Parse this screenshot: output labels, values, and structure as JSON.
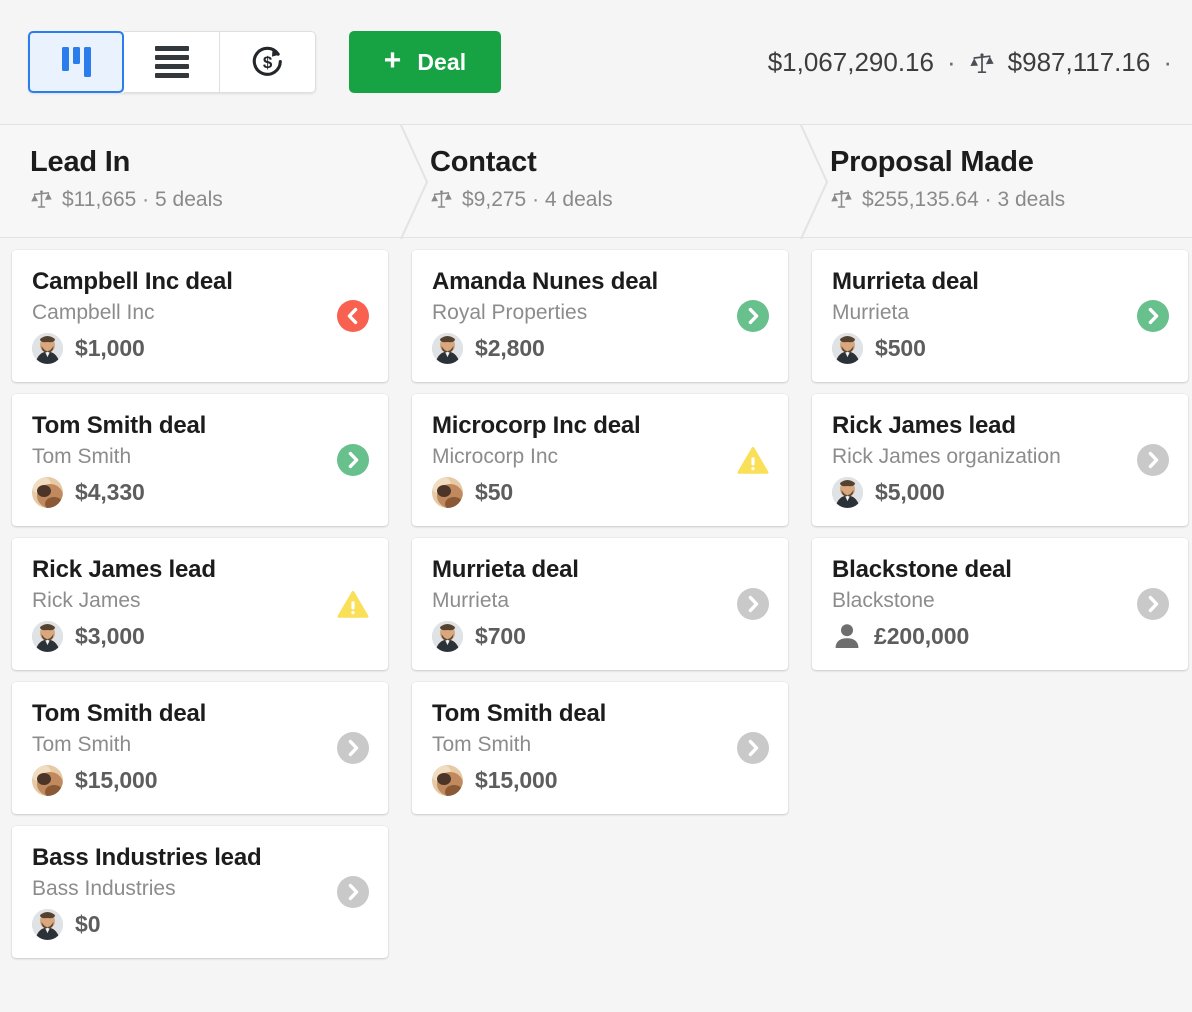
{
  "toolbar": {
    "views": [
      {
        "id": "pipeline",
        "icon": "pipeline-icon",
        "label": "Pipeline view",
        "active": true
      },
      {
        "id": "list",
        "icon": "list-icon",
        "label": "List view",
        "active": false
      },
      {
        "id": "forecast",
        "icon": "forecast-icon",
        "label": "Forecast view",
        "active": false
      }
    ],
    "add_deal_label": "Deal",
    "add_deal_plus": "+",
    "totals": {
      "total_value": "$1,067,290.16",
      "separator": "·",
      "weighted_icon": "scale-icon",
      "weighted_value": "$987,117.16",
      "trailing_separator": "·"
    },
    "accent_green": "#17a244",
    "accent_blue": "#2b7cec"
  },
  "stages": [
    {
      "name": "Lead In",
      "icon": "scale-icon",
      "summary": "$11,665 · 5 deals",
      "value": "$11,665",
      "deals": "5 deals"
    },
    {
      "name": "Contact",
      "icon": "scale-icon",
      "summary": "$9,275 · 4 deals",
      "value": "$9,275",
      "deals": "4 deals"
    },
    {
      "name": "Proposal Made",
      "icon": "scale-icon",
      "summary": "$255,135.64 · 3 deals",
      "value": "$255,135.64",
      "deals": "3 deals"
    }
  ],
  "columns": [
    {
      "stage": "Lead In",
      "cards": [
        {
          "title": "Campbell Inc deal",
          "org": "Campbell Inc",
          "value": "$1,000",
          "avatar": "photo-beard",
          "badge": "chevron-left-red",
          "badge_color": "#f8604f"
        },
        {
          "title": "Tom Smith deal",
          "org": "Tom Smith",
          "value": "$4,330",
          "avatar": "photo-warm",
          "badge": "chevron-right-green",
          "badge_color": "#68c08c"
        },
        {
          "title": "Rick James lead",
          "org": "Rick James",
          "value": "$3,000",
          "avatar": "photo-beard",
          "badge": "warning-triangle",
          "badge_color": "#fadf58"
        },
        {
          "title": "Tom Smith deal",
          "org": "Tom Smith",
          "value": "$15,000",
          "avatar": "photo-warm",
          "badge": "chevron-right-gray",
          "badge_color": "#c9c9c9"
        },
        {
          "title": "Bass Industries lead",
          "org": "Bass Industries",
          "value": "$0",
          "avatar": "photo-beard",
          "badge": "chevron-right-gray",
          "badge_color": "#c9c9c9"
        }
      ]
    },
    {
      "stage": "Contact",
      "cards": [
        {
          "title": "Amanda Nunes deal",
          "org": "Royal Properties",
          "value": "$2,800",
          "avatar": "photo-beard",
          "badge": "chevron-right-green",
          "badge_color": "#68c08c"
        },
        {
          "title": "Microcorp Inc deal",
          "org": "Microcorp Inc",
          "value": "$50",
          "avatar": "photo-warm",
          "badge": "warning-triangle",
          "badge_color": "#fadf58"
        },
        {
          "title": "Murrieta deal",
          "org": "Murrieta",
          "value": "$700",
          "avatar": "photo-beard",
          "badge": "chevron-right-gray",
          "badge_color": "#c9c9c9"
        },
        {
          "title": "Tom Smith deal",
          "org": "Tom Smith",
          "value": "$15,000",
          "avatar": "photo-warm",
          "badge": "chevron-right-gray",
          "badge_color": "#c9c9c9"
        }
      ]
    },
    {
      "stage": "Proposal Made",
      "cards": [
        {
          "title": "Murrieta deal",
          "org": "Murrieta",
          "value": "$500",
          "avatar": "photo-beard",
          "badge": "chevron-right-green",
          "badge_color": "#68c08c"
        },
        {
          "title": "Rick James lead",
          "org": "Rick James organization",
          "value": "$5,000",
          "avatar": "photo-beard",
          "badge": "chevron-right-gray",
          "badge_color": "#c9c9c9"
        },
        {
          "title": "Blackstone deal",
          "org": "Blackstone",
          "value": "£200,000",
          "avatar": "person-silhouette",
          "badge": "chevron-right-gray",
          "badge_color": "#c9c9c9"
        }
      ]
    }
  ]
}
